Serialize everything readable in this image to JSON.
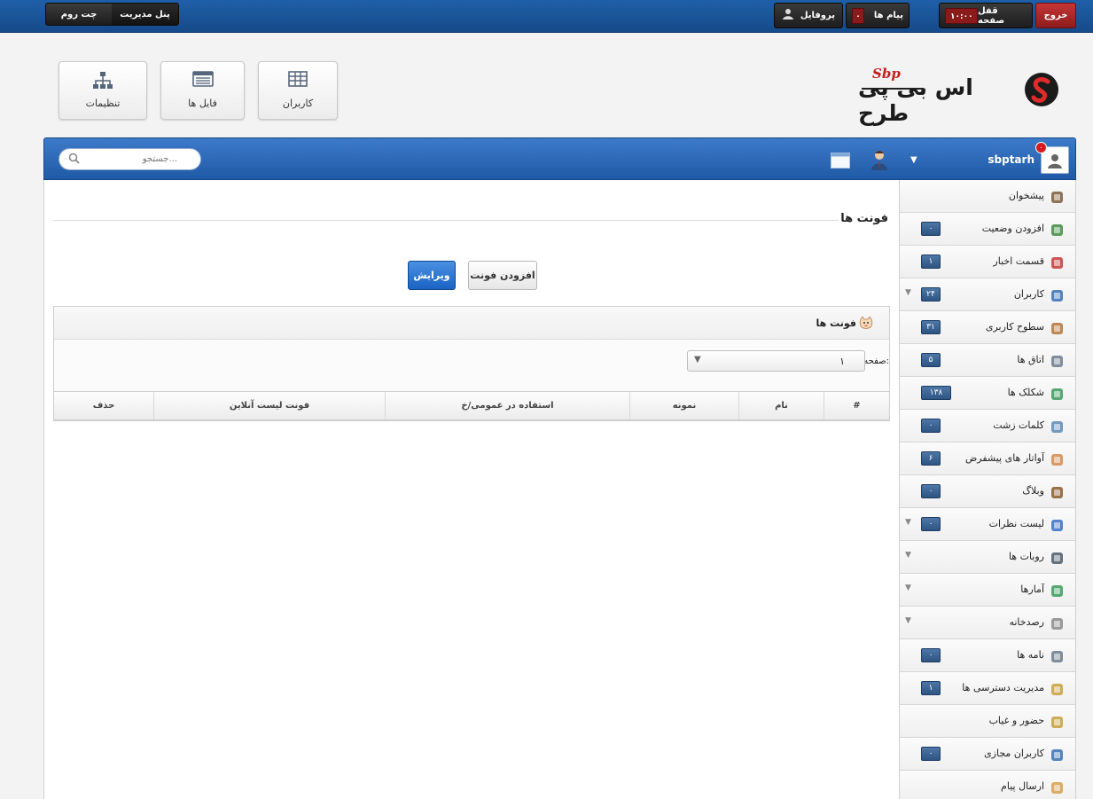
{
  "topbar": {
    "logout_label": "خروج",
    "lock_label": "قفل صفحه",
    "lock_time": "۱۰:۰۰",
    "messages_label": "پیام ها",
    "messages_count": "۰",
    "profile_label": "پروفایل",
    "breadcrumb": {
      "root": "پنل مدیریت",
      "current": "چت روم"
    }
  },
  "logo": {
    "text": "اس بی پی طرح",
    "mark": "Sbp"
  },
  "quick_links": [
    {
      "label": "کاربران",
      "icon": "table-icon"
    },
    {
      "label": "فایل ها",
      "icon": "file-list-icon"
    },
    {
      "label": "تنظیمات",
      "icon": "sitemap-icon"
    }
  ],
  "panel": {
    "username": "sbptarh",
    "notify_count": "۰",
    "search_placeholder": "جستجو..."
  },
  "sidebar": {
    "items": [
      {
        "label": "پیشخوان",
        "badge": "",
        "caret": false,
        "icon": "dashboard-icon"
      },
      {
        "label": "افزودن وضعیت",
        "badge": "۰",
        "caret": false,
        "icon": "user-status-icon"
      },
      {
        "label": "قسمت اخبار",
        "badge": "۱",
        "caret": false,
        "icon": "news-icon"
      },
      {
        "label": "کاربران",
        "badge": "۲۴",
        "caret": true,
        "icon": "user-icon"
      },
      {
        "label": "سطوح کاربری",
        "badge": "۳۱",
        "caret": false,
        "icon": "user-level-icon"
      },
      {
        "label": "اتاق ها",
        "badge": "۵",
        "caret": false,
        "icon": "room-icon"
      },
      {
        "label": "شکلک ها",
        "badge": "۱۳۸",
        "caret": false,
        "icon": "emoticon-icon"
      },
      {
        "label": "کلمات زشت",
        "badge": "۰",
        "caret": false,
        "icon": "bad-words-icon"
      },
      {
        "label": "آواتار های پیشفرض",
        "badge": "۶",
        "caret": false,
        "icon": "avatar-icon"
      },
      {
        "label": "وبلاگ",
        "badge": "۰",
        "caret": false,
        "icon": "blog-icon"
      },
      {
        "label": "لیست نظرات",
        "badge": "۰",
        "caret": true,
        "icon": "comments-icon"
      },
      {
        "label": "روبات ها",
        "badge": "",
        "caret": true,
        "icon": "robot-icon"
      },
      {
        "label": "آمارها",
        "badge": "",
        "caret": true,
        "icon": "stats-icon"
      },
      {
        "label": "رصدخانه",
        "badge": "",
        "caret": true,
        "icon": "observatory-icon"
      },
      {
        "label": "نامه ها",
        "badge": "۰",
        "caret": false,
        "icon": "mail-icon"
      },
      {
        "label": "مدیریت دسترسی ها",
        "badge": "۱",
        "caret": false,
        "icon": "lock-icon"
      },
      {
        "label": "حضور و غیاب",
        "badge": "",
        "caret": false,
        "icon": "attendance-icon"
      },
      {
        "label": "کاربران مجازی",
        "badge": "۰",
        "caret": false,
        "icon": "virtual-user-icon"
      },
      {
        "label": "ارسال پیام",
        "badge": "",
        "caret": false,
        "icon": "send-message-icon"
      }
    ]
  },
  "main": {
    "title": "فونت ها",
    "add_button": "افزودن فونت",
    "edit_button": "ویرایش",
    "box_title": "فونت ها",
    "pager_label": "صفحه:",
    "pager_value": "۱",
    "table_headers": [
      "#",
      "نام",
      "نمونه",
      "استفاده در عمومی/خ",
      "فونت لیست آنلاین",
      "حذف"
    ]
  }
}
